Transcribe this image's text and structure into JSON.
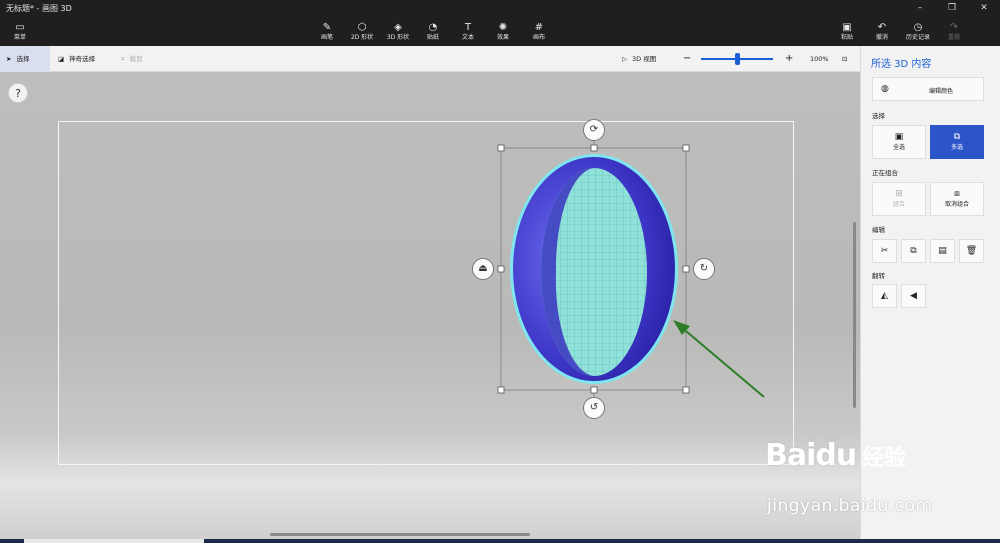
{
  "window": {
    "title": "无标题* - 画图 3D",
    "controls": [
      "–",
      "❐",
      "✕"
    ]
  },
  "ribbon": {
    "menu": {
      "icon": "folder-icon",
      "label": "菜单"
    },
    "tools": [
      {
        "label": "画笔",
        "icon": "brush-icon"
      },
      {
        "label": "2D 形状",
        "icon": "2d-shapes-icon"
      },
      {
        "label": "3D 形状",
        "icon": "3d-shapes-icon"
      },
      {
        "label": "贴纸",
        "icon": "sticker-icon"
      },
      {
        "label": "文本",
        "icon": "text-icon"
      },
      {
        "label": "效果",
        "icon": "effects-icon"
      },
      {
        "label": "画布",
        "icon": "canvas-icon"
      }
    ],
    "right_tools": [
      {
        "label": "粘贴",
        "icon": "paste-icon"
      },
      {
        "label": "撤消",
        "icon": "undo-icon"
      },
      {
        "label": "历史记录",
        "icon": "history-icon"
      },
      {
        "label": "重做",
        "icon": "redo-icon"
      }
    ]
  },
  "subbar": {
    "select": "选择",
    "magic_select": "神奇选择",
    "crop": "裁剪",
    "view_3d": "3D 视图",
    "zoom_out": "−",
    "zoom_in": "+",
    "zoom_level": "100%",
    "zoom_fraction": 0.5
  },
  "canvas": {
    "help": "?"
  },
  "panel": {
    "title": "所选 3D 内容",
    "edit_color": "编辑颜色",
    "select_section": "选择",
    "select_all": "全选",
    "multi_select": "多选",
    "group_section": "正在组合",
    "group": "组合",
    "ungroup": "取消组合",
    "edit_section": "编辑",
    "flip_section": "翻转"
  },
  "watermark": {
    "brand": "Baidu",
    "jingyan": "经验",
    "url": "jingyan.baidu.com"
  },
  "colors": {
    "accent": "#2c55c9",
    "ring_outer": "#4a3fd0",
    "ring_glow": "#7fe6f0",
    "mesh": "#8fe1d9",
    "arrow": "#2f7d2a"
  }
}
